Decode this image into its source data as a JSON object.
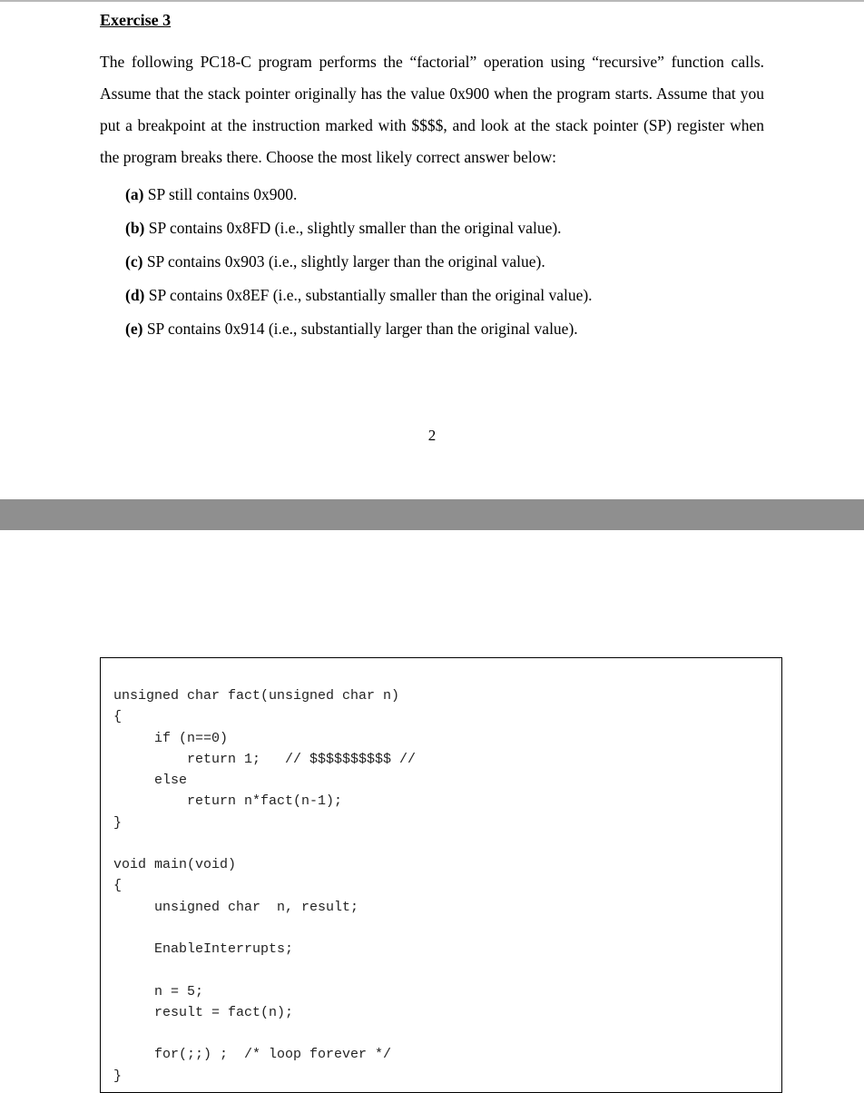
{
  "title": "Exercise 3",
  "intro": "The following PC18-C program performs the “factorial” operation using “recursive” function calls. Assume that the stack pointer originally has the value 0x900 when the program starts. Assume that you put a breakpoint at the instruction marked with $$$$, and look at the stack pointer (SP) register when the program breaks there. Choose the most likely correct answer below:",
  "options": {
    "a": {
      "label": "(a)",
      "text": " SP still contains 0x900."
    },
    "b": {
      "label": "(b)",
      "text": " SP contains 0x8FD (i.e., slightly smaller than the original value)."
    },
    "c": {
      "label": "(c)",
      "text": " SP contains 0x903 (i.e., slightly larger than the original value)."
    },
    "d": {
      "label": "(d)",
      "text": " SP contains 0x8EF (i.e., substantially smaller than the original value)."
    },
    "e": {
      "label": "(e)",
      "text": " SP contains 0x914 (i.e., substantially larger than the original value)."
    }
  },
  "page_number": "2",
  "code": "unsigned char fact(unsigned char n)\n{\n     if (n==0)\n         return 1;   // $$$$$$$$$$ //\n     else\n         return n*fact(n-1);\n}\n\nvoid main(void)\n{\n     unsigned char  n, result;\n\n     EnableInterrupts;\n\n     n = 5;\n     result = fact(n);\n\n     for(;;) ;  /* loop forever */\n}"
}
